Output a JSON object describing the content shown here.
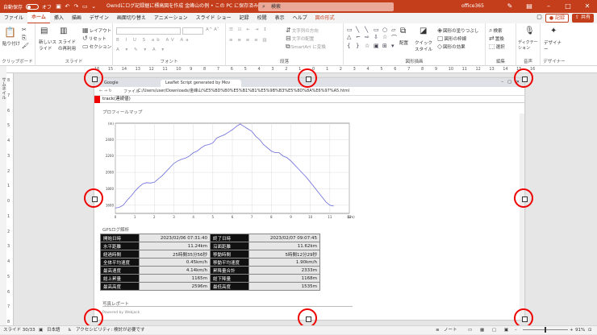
{
  "titlebar": {
    "autosave_label": "自動保存",
    "autosave_state": "オフ",
    "doc_title": "Owndにログ記録据に標高図を作成 金峰山の例 • この PC に保存済み",
    "search_placeholder": "検索",
    "account": "office365"
  },
  "tabs": [
    "ファイル",
    "ホーム",
    "挿入",
    "描画",
    "デザイン",
    "画面切り替え",
    "アニメーション",
    "スライド ショー",
    "記録",
    "校閲",
    "表示",
    "ヘルプ",
    "図の形式"
  ],
  "tab_right": {
    "record": "記録",
    "share": "共有"
  },
  "ribbon": {
    "clipboard": {
      "paste": "貼り付け",
      "label": "クリップボード"
    },
    "slides": {
      "new_slide": "新しいスライド",
      "reuse": "スライドの再利用",
      "layout": "レイアウト",
      "reset": "リセット",
      "section": "セクション",
      "label": "スライド"
    },
    "font": {
      "label": "フォント"
    },
    "paragraph": {
      "text_direction": "文字列の方向",
      "align_text": "文字の配置",
      "smartart": "SmartArt に変換",
      "label": "段落"
    },
    "drawing": {
      "arrange": "配置",
      "quick_style": "クイック スタイル",
      "fill": "図形の塗りつぶし",
      "outline": "図形の枠線",
      "effect": "図形の効果",
      "label": "図形描画"
    },
    "editing": {
      "find": "検索",
      "replace": "置換",
      "select": "選択",
      "label": "編集"
    },
    "voice": {
      "dictate": "ディクテーション",
      "label": "音声"
    },
    "designer": {
      "designer": "デザイナー",
      "label": "デザイナー"
    }
  },
  "left_pane": {
    "thumbnails": "サムネイル"
  },
  "hruler_ticks": [
    "16",
    "15",
    "14",
    "13",
    "12",
    "11",
    "10",
    "9",
    "8",
    "7",
    "6",
    "5",
    "4",
    "3",
    "2",
    "1",
    "0",
    "1",
    "2",
    "3",
    "4",
    "5",
    "6",
    "7",
    "8",
    "9",
    "10",
    "11",
    "12",
    "13",
    "14",
    "15",
    "16"
  ],
  "vruler_ticks": [
    "8",
    "7",
    "6",
    "5",
    "4",
    "3",
    "2",
    "1",
    "0",
    "1",
    "2",
    "3",
    "4",
    "5",
    "6",
    "7",
    "8"
  ],
  "browser": {
    "tab1": "Google",
    "tab2": "Leaflet Script generated by Mov",
    "url_label": "ファイル",
    "url": "C:/Users/user/Downloads/金峰山%E5%BD%B0%E5%B1%B1%E5%9B%B3%E5%8D%8A%E6%97%A5.html",
    "track_title": "track(連続値)",
    "profile_title": "プロフィールマップ",
    "stats_title": "GPSログ解析",
    "report_title": "写真レポート",
    "footer": "Powered by Webjack"
  },
  "chart_data": {
    "type": "line",
    "title": "",
    "xlabel": "",
    "ylabel": "",
    "x_unit": "(km)",
    "y_unit": "(m)",
    "xlim": [
      0,
      12
    ],
    "ylim": [
      1500,
      2600
    ],
    "x_ticks": [
      0,
      1,
      2,
      3,
      4,
      5,
      6,
      7,
      8,
      9,
      10,
      11,
      12
    ],
    "y_ticks": [
      1600,
      1800,
      2000,
      2200,
      2400
    ],
    "grid": true,
    "color": "#6b6bdc",
    "x": [
      0,
      0.2,
      0.4,
      0.6,
      0.8,
      1.0,
      1.2,
      1.4,
      1.6,
      1.8,
      2.0,
      2.2,
      2.4,
      2.6,
      2.8,
      3.0,
      3.2,
      3.4,
      3.6,
      3.8,
      4.0,
      4.2,
      4.4,
      4.6,
      4.8,
      5.0,
      5.2,
      5.4,
      5.6,
      5.8,
      6.0,
      6.2,
      6.4,
      6.6,
      6.8,
      7.0,
      7.2,
      7.4,
      7.6,
      7.8,
      8.0,
      8.2,
      8.4,
      8.6,
      8.8,
      9.0,
      9.2,
      9.4,
      9.6,
      9.8,
      10.0,
      10.2,
      10.4,
      10.6,
      10.8,
      11.0,
      11.2
    ],
    "y": [
      1565,
      1575,
      1600,
      1660,
      1710,
      1770,
      1820,
      1860,
      1875,
      1870,
      1880,
      1920,
      1960,
      2010,
      2060,
      2110,
      2140,
      2160,
      2175,
      2200,
      2240,
      2260,
      2300,
      2330,
      2340,
      2360,
      2420,
      2440,
      2460,
      2490,
      2520,
      2560,
      2590,
      2560,
      2530,
      2500,
      2440,
      2400,
      2340,
      2300,
      2260,
      2240,
      2240,
      2200,
      2180,
      2140,
      2090,
      2040,
      1990,
      1940,
      1880,
      1820,
      1760,
      1700,
      1640,
      1600,
      1590
    ]
  },
  "stats": [
    {
      "k1": "開始日時",
      "v1": "2023/02/06 07:31:40",
      "k2": "終了日時",
      "v2": "2023/02/07 09:07:45"
    },
    {
      "k1": "水平距離",
      "v1": "11.24km",
      "k2": "沿面距離",
      "v2": "11.62km"
    },
    {
      "k1": "経過時間",
      "v1": "25時間35分56秒",
      "k2": "移動時間",
      "v2": "5時間12分29秒"
    },
    {
      "k1": "全体平均速度",
      "v1": "0.45km/h",
      "k2": "移動平均速度",
      "v2": "1.90km/h"
    },
    {
      "k1": "最高速度",
      "v1": "4.14km/h",
      "k2": "昇降量合計",
      "v2": "2333m"
    },
    {
      "k1": "総上昇量",
      "v1": "1165m",
      "k2": "総下降量",
      "v2": "1168m"
    },
    {
      "k1": "最高高度",
      "v1": "2596m",
      "k2": "最低高度",
      "v2": "1535m"
    }
  ],
  "statusbar": {
    "slide": "スライド 30/33",
    "language": "日本語",
    "accessibility": "アクセシビリティ: 検討が必要です",
    "notes": "ノート",
    "zoom": "91%"
  }
}
